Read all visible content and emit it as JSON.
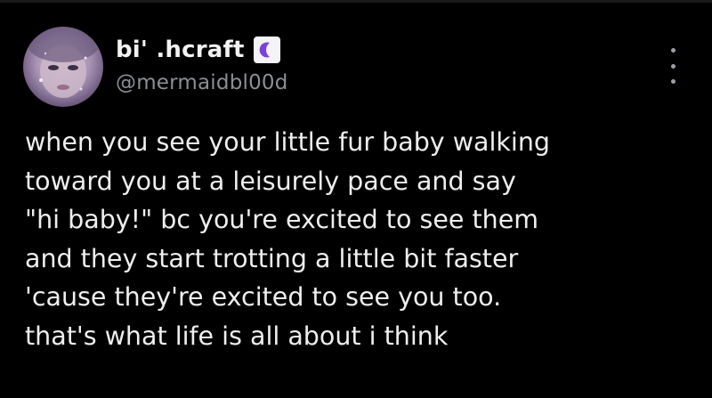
{
  "tweet": {
    "author": {
      "display_name": "bi' .hcraft",
      "handle": "@mermaidbl00d",
      "badge_icon": "crescent-moon-icon",
      "badge_color": "#7b3fe4",
      "avatar_icon": "profile-photo"
    },
    "more_icon": "vertical-ellipsis-icon",
    "text_lines": [
      "when you see your little fur baby walking",
      "toward you at a leisurely pace and say",
      "\"hi baby!\" bc you're excited to see them",
      "and they start trotting a little bit faster",
      "'cause they're excited to see you too.",
      "that's what life is all about i think"
    ]
  },
  "colors": {
    "background": "#000000",
    "text": "#eeeeee",
    "handle": "#8b8f94"
  }
}
